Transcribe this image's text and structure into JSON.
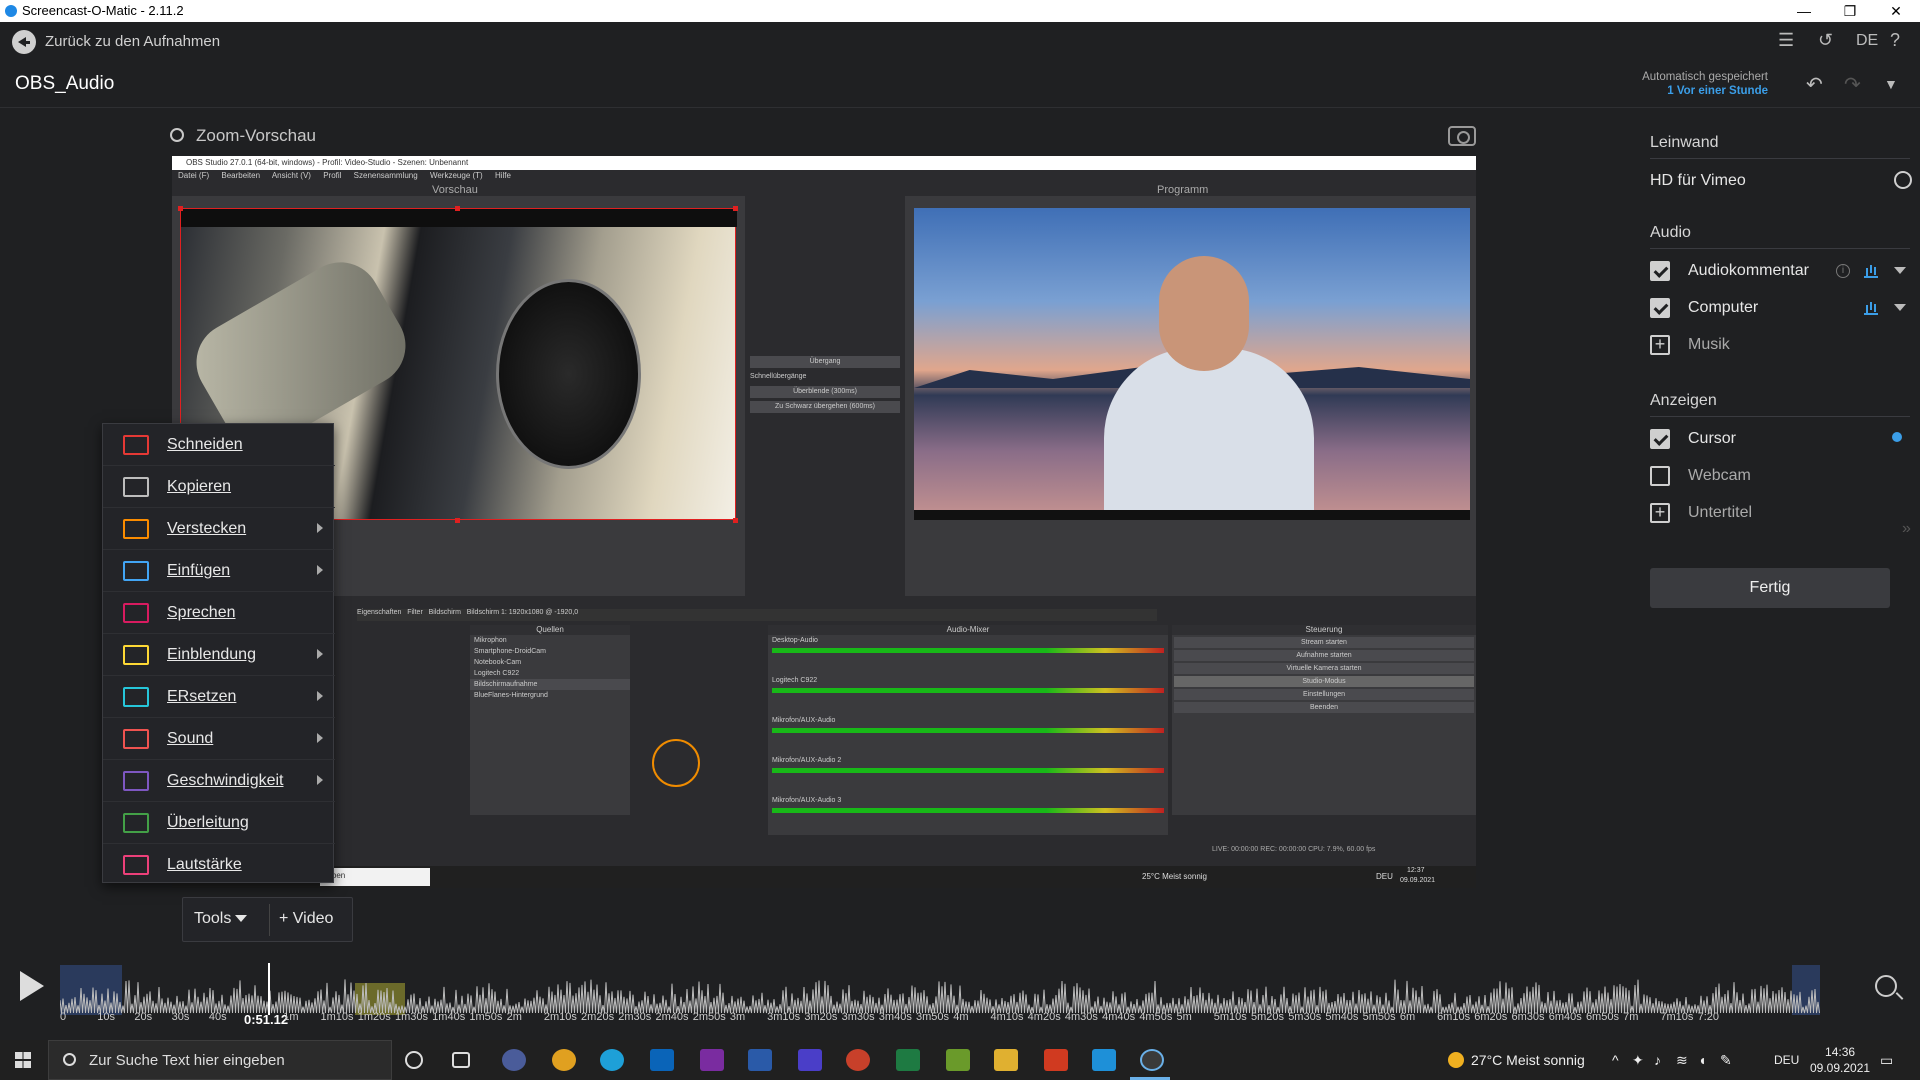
{
  "window": {
    "title": "Screencast-O-Matic - 2.11.2"
  },
  "nav": {
    "back_label": "Zurück zu den Aufnahmen",
    "lang": "DE",
    "help": "?"
  },
  "project": {
    "title": "OBS_Audio",
    "saved_label": "Automatisch gespeichert",
    "saved_time": "1 Vor einer Stunde"
  },
  "preview": {
    "zoom_label": "Zoom-Vorschau",
    "obs_title": "OBS Studio 27.0.1 (64-bit, windows) - Profil: Video-Studio - Szenen: Unbenannt",
    "obs_menu": [
      "Datei (F)",
      "Bearbeiten",
      "Ansicht (V)",
      "Profil",
      "Szenensammlung",
      "Werkzeuge (T)",
      "Hilfe"
    ],
    "vorschau": "Vorschau",
    "programm": "Programm",
    "transitions": [
      "Übergang",
      "Schnellübergänge",
      "Überblende (300ms)",
      "Zu Schwarz übergehen (600ms)"
    ],
    "props_bar": [
      "Eigenschaften",
      "Filter",
      "Bildschirm",
      "Bildschirm 1: 1920x1080 @ -1920,0"
    ],
    "sources_header": "Quellen",
    "sources": [
      "Mikrophon",
      "Smartphone-DroidCam",
      "Notebook-Cam",
      "Logitech C922",
      "Bildschirmaufnahme",
      "BlueFlanes-Hintergrund"
    ],
    "mixer_header": "Audio-Mixer",
    "mixer": [
      "Desktop-Audio",
      "Logitech C922",
      "Mikrofon/AUX-Audio",
      "Mikrofon/AUX-Audio 2",
      "Mikrofon/AUX-Audio 3"
    ],
    "controls_header": "Steuerung",
    "controls": [
      "Stream starten",
      "Aufnahme starten",
      "Virtuelle Kamera starten",
      "Studio-Modus",
      "Einstellungen",
      "Beenden"
    ],
    "status": "LIVE: 00:00:00   REC: 00:00:00   CPU: 7.9%, 60.00 fps",
    "inner_search": "geben",
    "inner_weather": "25°C  Meist sonnig",
    "inner_lang": "DEU",
    "inner_time": "12:37",
    "inner_date": "09.09.2021"
  },
  "tools_menu": {
    "items": [
      {
        "label": "Schneiden",
        "color": "#e53935",
        "submenu": false
      },
      {
        "label": "Kopieren",
        "color": "#bdbdbd",
        "submenu": false
      },
      {
        "label": "Verstecken",
        "color": "#fb8c00",
        "submenu": true
      },
      {
        "label": "Einfügen",
        "color": "#42a5f5",
        "submenu": true
      },
      {
        "label": "Sprechen",
        "color": "#d81b60",
        "submenu": false
      },
      {
        "label": "Einblendung",
        "color": "#fdd835",
        "submenu": true
      },
      {
        "label": "ERsetzen",
        "color": "#26c6da",
        "submenu": true
      },
      {
        "label": "Sound",
        "color": "#ef5350",
        "submenu": true
      },
      {
        "label": "Geschwindigkeit",
        "color": "#7e57c2",
        "submenu": true
      },
      {
        "label": "Überleitung",
        "color": "#43a047",
        "submenu": false
      },
      {
        "label": "Lautstärke",
        "color": "#ec407a",
        "submenu": false
      }
    ]
  },
  "toolbar": {
    "tools_label": "Tools",
    "video_label": "+ Video"
  },
  "timeline": {
    "current": "0:51.12",
    "ticks": [
      "0",
      "10s",
      "20s",
      "30s",
      "40s",
      "50s",
      "1m",
      "1m10s",
      "1m20s",
      "1m30s",
      "1m40s",
      "1m50s",
      "2m",
      "2m10s",
      "2m20s",
      "2m30s",
      "2m40s",
      "2m50s",
      "3m",
      "3m10s",
      "3m20s",
      "3m30s",
      "3m40s",
      "3m50s",
      "4m",
      "4m10s",
      "4m20s",
      "4m30s",
      "4m40s",
      "4m50s",
      "5m",
      "5m10s",
      "5m20s",
      "5m30s",
      "5m40s",
      "5m50s",
      "6m",
      "6m10s",
      "6m20s",
      "6m30s",
      "6m40s",
      "6m50s",
      "7m",
      "7m10s",
      "7:20"
    ]
  },
  "sidebar": {
    "canvas_header": "Leinwand",
    "canvas_option": "HD für Vimeo",
    "audio_header": "Audio",
    "audio": [
      {
        "label": "Audiokommentar",
        "checked": true
      },
      {
        "label": "Computer",
        "checked": true
      },
      {
        "label": "Musik",
        "checked": false
      }
    ],
    "display_header": "Anzeigen",
    "display": [
      {
        "label": "Cursor",
        "checked": true
      },
      {
        "label": "Webcam",
        "checked": false
      },
      {
        "label": "Untertitel",
        "checked": false
      }
    ],
    "done_label": "Fertig"
  },
  "taskbar": {
    "search_placeholder": "Zur Suche Text hier eingeben",
    "weather": "27°C  Meist sonnig",
    "lang": "DEU",
    "time": "14:36",
    "date": "09.09.2021"
  }
}
